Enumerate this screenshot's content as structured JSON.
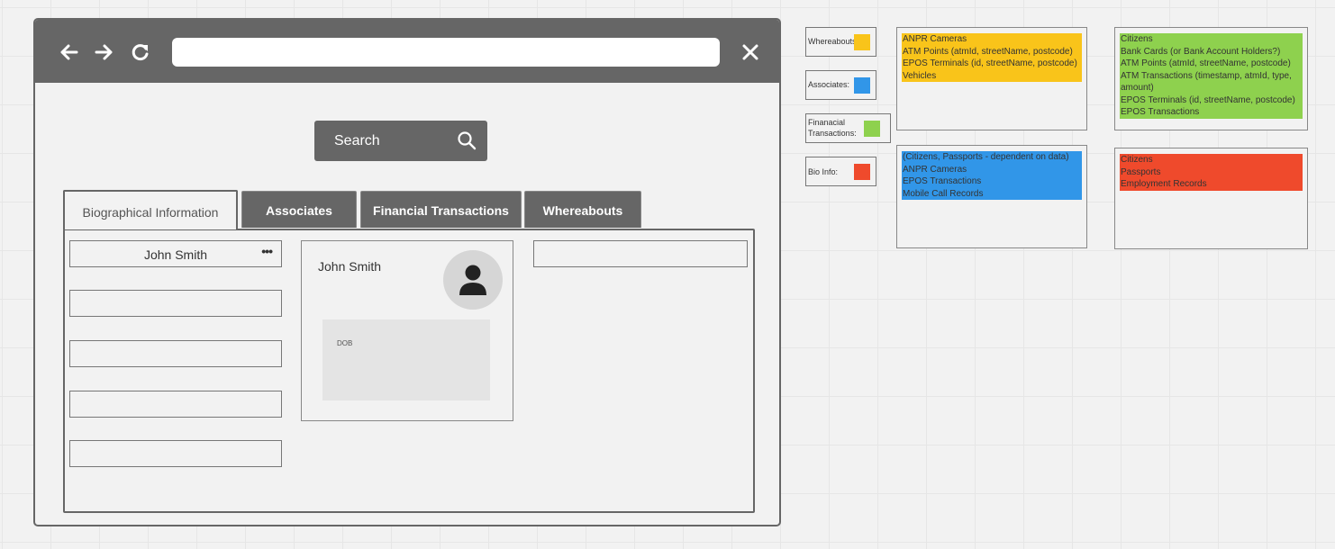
{
  "browser": {
    "back_icon": "arrow-left-icon",
    "forward_icon": "arrow-right-icon",
    "reload_icon": "reload-icon",
    "close_icon": "close-icon",
    "url_value": ""
  },
  "search": {
    "label": "Search",
    "icon": "search-icon"
  },
  "tabs": [
    {
      "label": "Biographical Information",
      "active": true
    },
    {
      "label": "Associates",
      "active": false
    },
    {
      "label": "Financial Transactions",
      "active": false
    },
    {
      "label": "Whereabouts",
      "active": false
    }
  ],
  "bio": {
    "name_field": "John Smith",
    "more_icon": "more-dots-icon",
    "card_name": "John Smith",
    "avatar_icon": "person-icon",
    "dob_label": "DOB"
  },
  "legend": [
    {
      "label": "Whereabouts:",
      "color": "#f9c41a"
    },
    {
      "label": "Associates:",
      "color": "#3196e8"
    },
    {
      "label": "Finanacial\nTransactions:",
      "color": "#8ed14e"
    },
    {
      "label": "Bio Info:",
      "color": "#ef4a2c"
    }
  ],
  "notes": {
    "whereabouts": [
      "ANPR Cameras",
      "ATM Points (atmId, streetName, postcode)",
      "EPOS Terminals (id, streetName, postcode)",
      "Vehicles"
    ],
    "financial": [
      "Citizens",
      "Bank Cards (or Bank Account Holders?)",
      "ATM Points (atmId, streetName, postcode)",
      "ATM Transactions (timestamp, atmId, type,",
      "amount)",
      "EPOS Terminals (id, streetName, postcode)",
      "EPOS Transactions"
    ],
    "associates": [
      "(Citizens, Passports - dependent on data)",
      "ANPR Cameras",
      "EPOS Transactions",
      "Mobile Call Records"
    ],
    "bio": [
      "Citizens",
      "Passports",
      "Employment Records"
    ]
  }
}
